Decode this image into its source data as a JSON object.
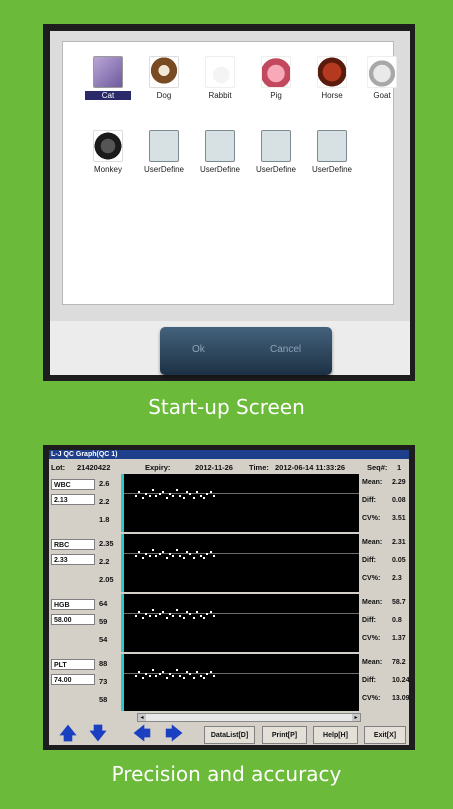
{
  "captions": {
    "top": "Start-up Screen",
    "bottom": "Precision and accuracy"
  },
  "startup": {
    "animals": [
      {
        "label": "Cat",
        "icon": "cat-icon",
        "selected": true
      },
      {
        "label": "Dog",
        "icon": "dog-icon"
      },
      {
        "label": "Rabbit",
        "icon": "rabbit-icon"
      },
      {
        "label": "Pig",
        "icon": "pig-icon"
      },
      {
        "label": "Horse",
        "icon": "horse-icon"
      },
      {
        "label": "Goat",
        "icon": "goat-icon"
      },
      {
        "label": "Monkey",
        "icon": "monkey-icon"
      },
      {
        "label": "UserDefine",
        "icon": "user-define-icon"
      },
      {
        "label": "UserDefine",
        "icon": "user-define-icon"
      },
      {
        "label": "UserDefine",
        "icon": "user-define-icon"
      },
      {
        "label": "UserDefine",
        "icon": "user-define-icon"
      }
    ],
    "ok_label": "Ok",
    "cancel_label": "Cancel"
  },
  "qc": {
    "title": "L-J QC Graph(QC 1)",
    "lot_label": "Lot:",
    "lot": "21420422",
    "expiry_label": "Expiry:",
    "expiry": "2012-11-26",
    "time_label": "Time:",
    "time": "2012-06-14 11:33:26",
    "seq_label": "Seq#:",
    "seq": "1",
    "params": [
      {
        "name": "WBC",
        "value": "2.13",
        "limits": [
          "2.6",
          "2.2",
          "1.8"
        ],
        "mean": "2.29",
        "diff": "0.08",
        "cv": "3.51"
      },
      {
        "name": "RBC",
        "value": "2.33",
        "limits": [
          "2.35",
          "2.2",
          "2.05"
        ],
        "mean": "2.31",
        "diff": "0.05",
        "cv": "2.3"
      },
      {
        "name": "HGB",
        "value": "58.00",
        "limits": [
          "64",
          "59",
          "54"
        ],
        "mean": "58.7",
        "diff": "0.8",
        "cv": "1.37"
      },
      {
        "name": "PLT",
        "value": "74.00",
        "limits": [
          "88",
          "73",
          "58"
        ],
        "mean": "78.2",
        "diff": "10.24",
        "cv": "13.09"
      }
    ],
    "stat_labels": {
      "mean": "Mean:",
      "diff": "Diff:",
      "cv": "CV%:"
    },
    "buttons": {
      "datalist": "DataList[D]",
      "print": "Print[P]",
      "help": "Help[H]",
      "exit": "Exit[X]"
    },
    "nav_icons": [
      "up-arrow-icon",
      "down-arrow-icon",
      "left-arrow-icon",
      "right-arrow-icon"
    ]
  }
}
